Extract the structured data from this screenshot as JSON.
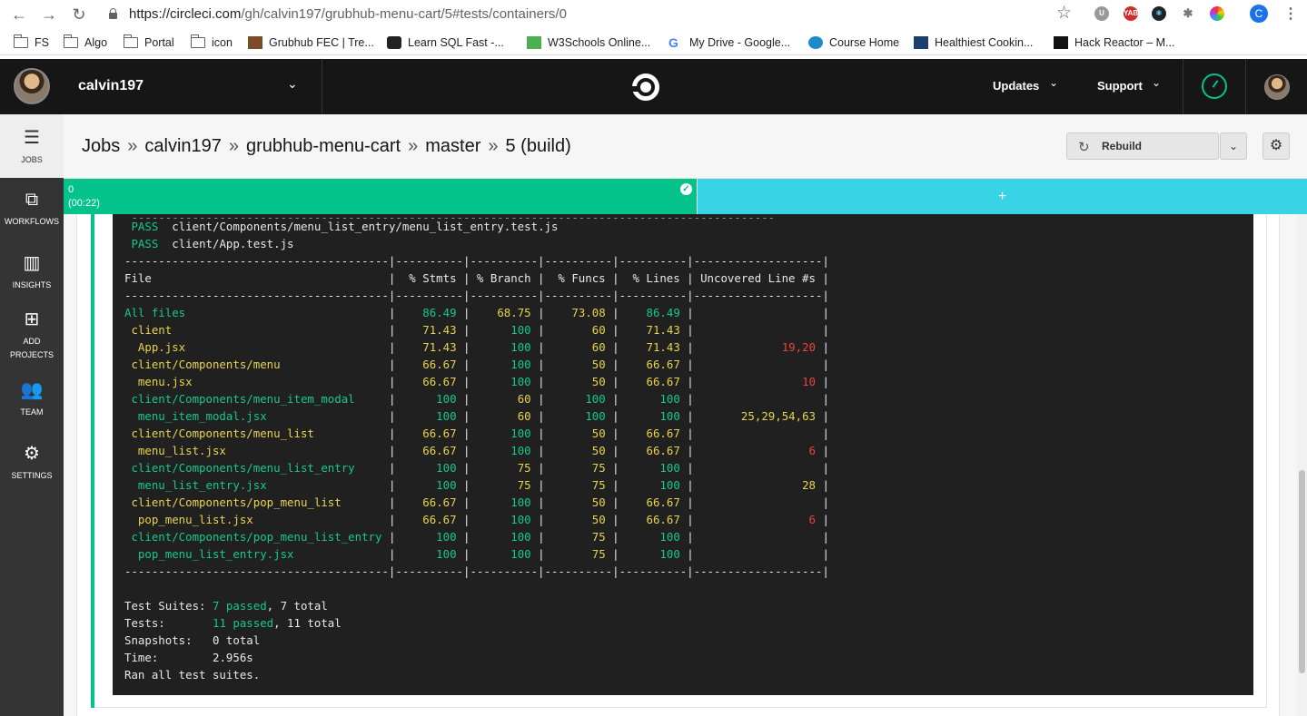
{
  "browser": {
    "url_host": "https://circleci.com",
    "url_path": "/gh/calvin197/grubhub-menu-cart/5#tests/containers/0",
    "profile_initial": "C",
    "bookmarks": [
      "FS",
      "Algo",
      "Portal",
      "icon",
      "Grubhub FEC | Tre...",
      "Learn SQL Fast -...",
      "W3Schools Online...",
      "My Drive - Google...",
      "Course Home",
      "Healthiest Cookin...",
      "Hack Reactor – M..."
    ],
    "bookmarks_more": "»"
  },
  "header": {
    "org_name": "calvin197",
    "updates": "Updates",
    "support": "Support"
  },
  "sidebar": {
    "items": [
      {
        "label": "JOBS"
      },
      {
        "label": "WORKFLOWS"
      },
      {
        "label": "INSIGHTS"
      },
      {
        "label": "ADD",
        "label2": "PROJECTS"
      },
      {
        "label": "TEAM"
      },
      {
        "label": "SETTINGS"
      }
    ]
  },
  "breadcrumb": {
    "items": [
      "Jobs",
      "calvin197",
      "grubhub-menu-cart",
      "master",
      "5 (build)"
    ],
    "sep": "»"
  },
  "actions": {
    "rebuild": "Rebuild"
  },
  "containers": {
    "index": "0",
    "duration": "(00:22)",
    "add": "+"
  },
  "terminal": {
    "pass_lines": [
      {
        "status": "PASS",
        "path": "client/Components/menu_list_entry/menu_list_entry.test.js"
      },
      {
        "status": "PASS",
        "path": "client/App.test.js"
      }
    ],
    "divider": "---------------------------------------|----------|----------|----------|----------|-------------------|",
    "header": {
      "file": "File",
      "stmts": "% Stmts",
      "branch": "% Branch",
      "funcs": "% Funcs",
      "lines": "% Lines",
      "uncovered": "Uncovered Line #s"
    },
    "rows": [
      {
        "file": "All files",
        "indent": 0,
        "stmts": "86.49",
        "branch": "68.75",
        "funcs": "73.08",
        "lines": "86.49",
        "uncovered": ""
      },
      {
        "file": "client",
        "indent": 1,
        "stmts": "71.43",
        "branch": "100",
        "funcs": "60",
        "lines": "71.43",
        "uncovered": ""
      },
      {
        "file": "App.jsx",
        "indent": 2,
        "stmts": "71.43",
        "branch": "100",
        "funcs": "60",
        "lines": "71.43",
        "uncovered": "19,20"
      },
      {
        "file": "client/Components/menu",
        "indent": 1,
        "stmts": "66.67",
        "branch": "100",
        "funcs": "50",
        "lines": "66.67",
        "uncovered": ""
      },
      {
        "file": "menu.jsx",
        "indent": 2,
        "stmts": "66.67",
        "branch": "100",
        "funcs": "50",
        "lines": "66.67",
        "uncovered": "10"
      },
      {
        "file": "client/Components/menu_item_modal",
        "indent": 1,
        "stmts": "100",
        "branch": "60",
        "funcs": "100",
        "lines": "100",
        "uncovered": ""
      },
      {
        "file": "menu_item_modal.jsx",
        "indent": 2,
        "stmts": "100",
        "branch": "60",
        "funcs": "100",
        "lines": "100",
        "uncovered": "25,29,54,63"
      },
      {
        "file": "client/Components/menu_list",
        "indent": 1,
        "stmts": "66.67",
        "branch": "100",
        "funcs": "50",
        "lines": "66.67",
        "uncovered": ""
      },
      {
        "file": "menu_list.jsx",
        "indent": 2,
        "stmts": "66.67",
        "branch": "100",
        "funcs": "50",
        "lines": "66.67",
        "uncovered": "6"
      },
      {
        "file": "client/Components/menu_list_entry",
        "indent": 1,
        "stmts": "100",
        "branch": "75",
        "funcs": "75",
        "lines": "100",
        "uncovered": ""
      },
      {
        "file": "menu_list_entry.jsx",
        "indent": 2,
        "stmts": "100",
        "branch": "75",
        "funcs": "75",
        "lines": "100",
        "uncovered": "28"
      },
      {
        "file": "client/Components/pop_menu_list",
        "indent": 1,
        "stmts": "66.67",
        "branch": "100",
        "funcs": "50",
        "lines": "66.67",
        "uncovered": ""
      },
      {
        "file": "pop_menu_list.jsx",
        "indent": 2,
        "stmts": "66.67",
        "branch": "100",
        "funcs": "50",
        "lines": "66.67",
        "uncovered": "6"
      },
      {
        "file": "client/Components/pop_menu_list_entry",
        "indent": 1,
        "stmts": "100",
        "branch": "100",
        "funcs": "75",
        "lines": "100",
        "uncovered": ""
      },
      {
        "file": "pop_menu_list_entry.jsx",
        "indent": 2,
        "stmts": "100",
        "branch": "100",
        "funcs": "75",
        "lines": "100",
        "uncovered": ""
      }
    ],
    "summary": [
      {
        "label": "Test Suites: ",
        "passed": "7 passed",
        "rest": ", 7 total"
      },
      {
        "label": "Tests:       ",
        "passed": "11 passed",
        "rest": ", 11 total"
      },
      {
        "label": "Snapshots:   ",
        "passed": "",
        "rest": "0 total"
      },
      {
        "label": "Time:        ",
        "passed": "",
        "rest": "2.956s"
      },
      {
        "label": "Ran all test suites.",
        "passed": "",
        "rest": ""
      }
    ]
  },
  "colors": {
    "success": "#04c38a",
    "add_container": "#39d3e6",
    "term_green": "#17c88c",
    "term_yellow": "#e8d44d",
    "term_red": "#e8453c"
  }
}
